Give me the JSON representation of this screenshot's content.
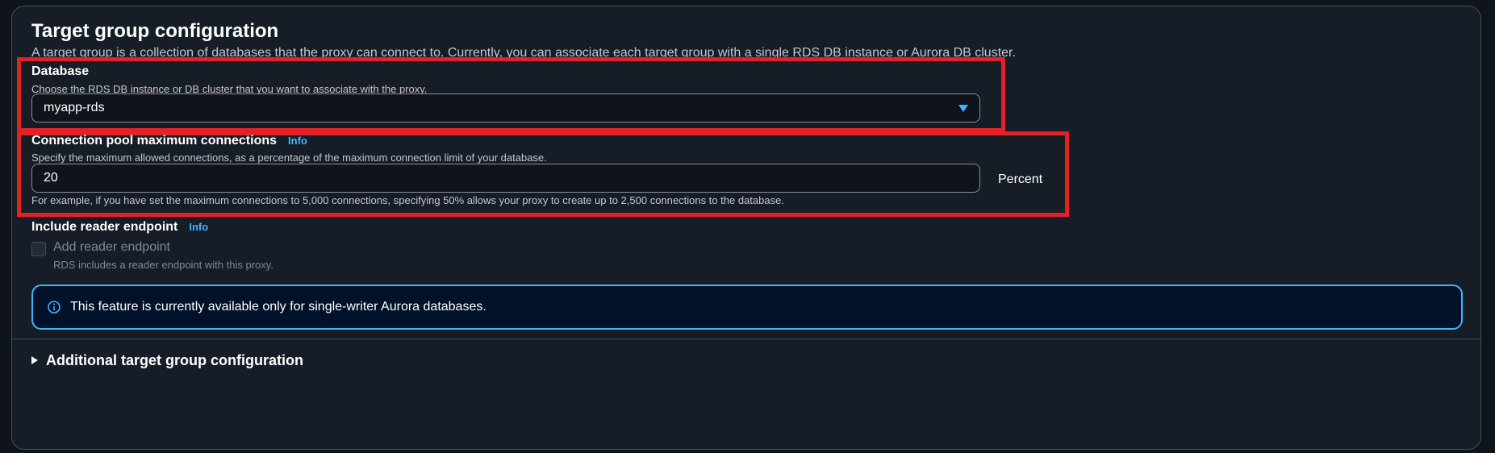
{
  "section": {
    "title": "Target group configuration",
    "description": "A target group is a collection of databases that the proxy can connect to. Currently, you can associate each target group with a single RDS DB instance or Aurora DB cluster."
  },
  "database": {
    "label": "Database",
    "hint": "Choose the RDS DB instance or DB cluster that you want to associate with the proxy.",
    "selected_value": "myapp-rds"
  },
  "connection_pool": {
    "label": "Connection pool maximum connections",
    "info": "Info",
    "hint": "Specify the maximum allowed connections, as a percentage of the maximum connection limit of your database.",
    "value": "20",
    "unit": "Percent",
    "example": "For example, if you have set the maximum connections to 5,000 connections, specifying 50% allows your proxy to create up to 2,500 connections to the database."
  },
  "reader_endpoint": {
    "label": "Include reader endpoint",
    "info": "Info",
    "checkbox_label": "Add reader endpoint",
    "checkbox_desc": "RDS includes a reader endpoint with this proxy.",
    "checked": false
  },
  "alert": {
    "icon": "info-icon",
    "text": "This feature is currently available only for single-writer Aurora databases."
  },
  "additional": {
    "label": "Additional target group configuration"
  },
  "colors": {
    "accent": "#42b4ff",
    "highlight": "#e32226",
    "background": "#161d26"
  }
}
